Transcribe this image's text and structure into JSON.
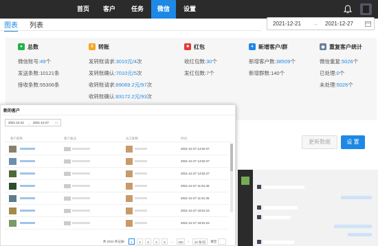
{
  "nav": {
    "items": [
      "首页",
      "客户",
      "任务",
      "微信",
      "设置"
    ],
    "active_index": 3
  },
  "tabs": [
    "图表",
    "列表"
  ],
  "date_range": {
    "start": "2021-12-21",
    "separator": "→",
    "end": "2021-12-27"
  },
  "stats": {
    "total": {
      "title": "总数",
      "rows": [
        {
          "label": "微信账号:",
          "value": "49",
          "unit": "个"
        },
        {
          "label": "发送条数:10121条",
          "value": "",
          "unit": ""
        },
        {
          "label": "接收条数:55306条",
          "value": "",
          "unit": ""
        }
      ]
    },
    "transfer": {
      "title": "转账",
      "rows": [
        {
          "label": "发转账请求:",
          "value": "3010元/4",
          "unit": "次"
        },
        {
          "label": "发转账确认:",
          "value": "7010元/5",
          "unit": "次"
        },
        {
          "label": "收转账请求:",
          "value": "89069.2元/97",
          "unit": "次"
        },
        {
          "label": "收转账确认:",
          "value": "83172.2元/93",
          "unit": "次"
        }
      ]
    },
    "redpacket": {
      "title": "红包",
      "rows": [
        {
          "label": "收红包数:",
          "value": "30",
          "unit": "个"
        },
        {
          "label": "发红包数:",
          "value": "7",
          "unit": "个"
        }
      ]
    },
    "new_customers": {
      "title": "新增客户/群",
      "rows": [
        {
          "label": "新增客户数:",
          "value": "38509",
          "unit": "个"
        },
        {
          "label": "新增群数:140个",
          "value": "",
          "unit": ""
        }
      ]
    },
    "duplicates": {
      "title": "重复客户统计",
      "rows": [
        {
          "label": "微信重复:",
          "value": "5026",
          "unit": "个"
        },
        {
          "label": "已处理:",
          "value": "0",
          "unit": "个"
        },
        {
          "label": "未处理:",
          "value": "5026",
          "unit": "个"
        }
      ]
    }
  },
  "buttons": {
    "refresh": "更新数据",
    "settings": "设 置"
  },
  "modal": {
    "title": "新的客户",
    "date_start": "2021-12-21",
    "date_sep": "→",
    "date_end": "2021-12-27",
    "columns": [
      "客户昵称",
      "客户备注",
      "员工昵称",
      "时间"
    ],
    "rows": [
      {
        "time": "2021-12-27 14:52:47"
      },
      {
        "time": "2021-12-27 14:52:47"
      },
      {
        "time": "2021-12-27 14:52:47"
      },
      {
        "time": "2021-12-27 11:51:45"
      },
      {
        "time": "2021-12-27 11:51:45"
      },
      {
        "time": "2021-12-27 10:51:24"
      },
      {
        "time": "2021-12-27 10:51:24"
      }
    ],
    "pager": {
      "total": "共 2022 条记录",
      "pages": [
        "1",
        "2",
        "3",
        "4",
        "5",
        "...",
        "202"
      ],
      "page_size": "10 条/页",
      "goto": "跳至"
    }
  },
  "colors": {
    "accent": "#1e88e5",
    "nav_bg": "#2b2b2b",
    "icon_total": "#21b24a",
    "icon_transfer": "#f5a623",
    "icon_redpacket": "#e53935",
    "icon_new": "#1e88e5",
    "icon_dup": "#6b7f99"
  },
  "icons": [
    "bell-icon",
    "user-avatar",
    "calendar-icon",
    "wechat-icon",
    "transfer-icon",
    "redpacket-icon",
    "customer-icon",
    "duplicate-icon"
  ]
}
